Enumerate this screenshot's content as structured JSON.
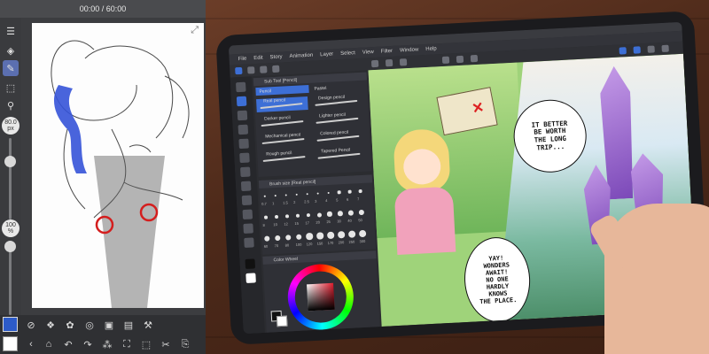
{
  "phone_app": {
    "timer": "00:00 / 60:00",
    "brush_size": {
      "value": "80.0",
      "unit": "px"
    },
    "opacity": {
      "value": "100",
      "unit": "%"
    },
    "colors": {
      "main": "#2d5bc9",
      "sub": "#ffffff"
    }
  },
  "tablet_app": {
    "menu": [
      "File",
      "Edit",
      "Story",
      "Animation",
      "Layer",
      "Select",
      "View",
      "Filter",
      "Window",
      "Help"
    ],
    "subtool_panel": {
      "title": "Sub Tool [Pencil]",
      "tabs": [
        "Pencil",
        "Pastel"
      ],
      "pencils": [
        "Real pencil",
        "Design pencil",
        "Darker pencil",
        "Lighter pencil",
        "Mechanical pencil",
        "Colored pencil",
        "Rough pencil",
        "Tapered Pencil"
      ]
    },
    "brush_size_panel": {
      "title": "Brush size [Real pencil]",
      "sizes": [
        "0.7",
        "1",
        "1.5",
        "2",
        "2.5",
        "3",
        "4",
        "5",
        "6",
        "7",
        "8",
        "10",
        "12",
        "15",
        "17",
        "20",
        "25",
        "30",
        "40",
        "50",
        "60",
        "70",
        "80",
        "100",
        "120",
        "150",
        "170",
        "200",
        "250",
        "300"
      ]
    },
    "color_panel": {
      "title": "Color Wheel"
    },
    "comic": {
      "bubble_top": "IT BETTER\nBE WORTH\nTHE LONG\nTRIP...",
      "bubble_bottom": "YAY!\nWONDERS\nAWAIT!\nNO ONE\nHARDLY\nKNOWS\nTHE PLACE."
    }
  }
}
